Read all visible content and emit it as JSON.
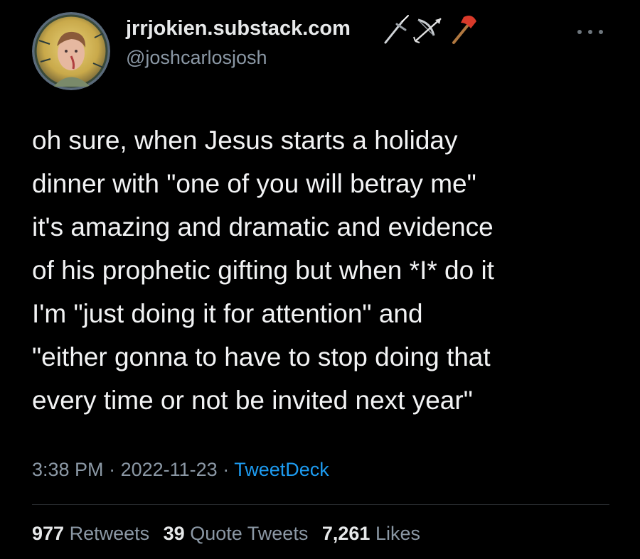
{
  "author": {
    "display_name": "jrrjokien.substack.com",
    "handle": "@joshcarlosjosh",
    "name_emojis": [
      "dagger-icon",
      "bow-and-arrow-icon",
      "axe-icon"
    ]
  },
  "tweet": {
    "lines": [
      "oh sure, when Jesus starts a holiday",
      "dinner with \"one of you will betray me\"",
      "it's amazing and dramatic and evidence",
      "of his prophetic gifting but when *I* do it",
      "I'm \"just doing it for attention\" and",
      "\"either gonna to have to stop doing that",
      "every time or not be invited next year\""
    ]
  },
  "meta": {
    "time": "3:38 PM",
    "separator": "·",
    "date": "2022-11-23",
    "source": "TweetDeck"
  },
  "stats": {
    "retweets_count": "977",
    "retweets_label": "Retweets",
    "quotes_count": "39",
    "quotes_label": "Quote Tweets",
    "likes_count": "7,261",
    "likes_label": "Likes"
  },
  "colors": {
    "background": "#000000",
    "text": "#e7e9ea",
    "secondary": "#8b98a5",
    "link": "#1d9bf0"
  }
}
